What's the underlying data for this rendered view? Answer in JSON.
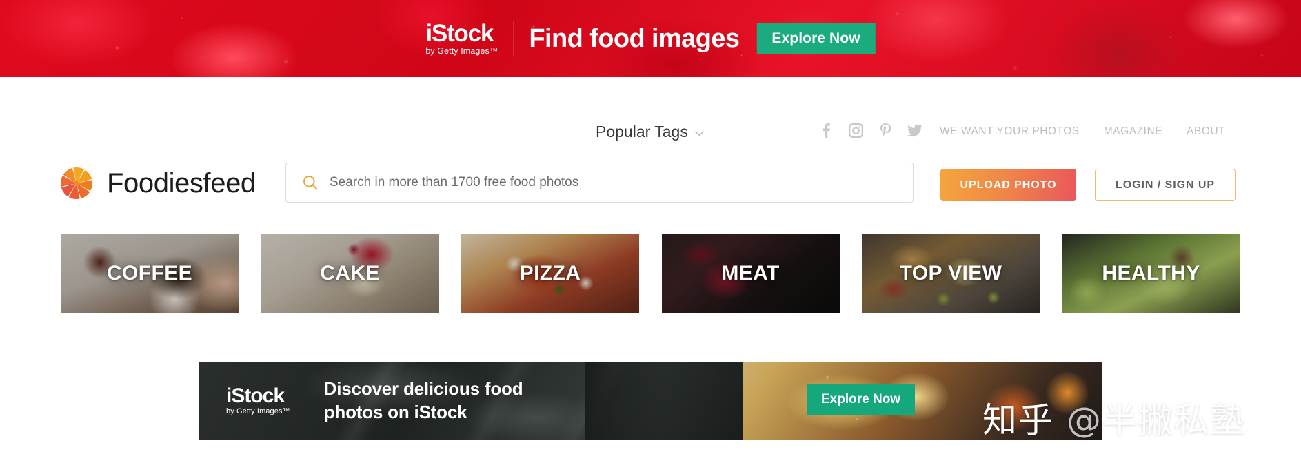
{
  "top_banner": {
    "brand": "iStock",
    "brand_sub": "by Getty Images™",
    "headline": "Find food images",
    "cta": "Explore Now",
    "bg_color": "#d9071b",
    "cta_color": "#1aab7e"
  },
  "util_nav": {
    "popular_tags": "Popular Tags",
    "chevron": "⌄",
    "social": [
      {
        "name": "facebook-icon"
      },
      {
        "name": "instagram-icon"
      },
      {
        "name": "pinterest-icon"
      },
      {
        "name": "twitter-icon"
      }
    ],
    "links": [
      {
        "label": "WE WANT YOUR PHOTOS"
      },
      {
        "label": "MAGAZINE"
      },
      {
        "label": "ABOUT"
      }
    ]
  },
  "header": {
    "logo_text": "Foodiesfeed",
    "logo_icon": "aperture-icon",
    "search": {
      "icon": "search-icon",
      "placeholder": "Search in more than 1700 free food photos",
      "value": ""
    },
    "upload_label": "UPLOAD PHOTO",
    "login_label": "LOGIN / SIGN UP",
    "accent_orange": "#f4a63c",
    "accent_red": "#e9575c"
  },
  "tiles": [
    {
      "label": "COFFEE",
      "bg": "bg-coffee"
    },
    {
      "label": "CAKE",
      "bg": "bg-cake"
    },
    {
      "label": "PIZZA",
      "bg": "bg-pizza"
    },
    {
      "label": "MEAT",
      "bg": "bg-meat"
    },
    {
      "label": "TOP VIEW",
      "bg": "bg-topview"
    },
    {
      "label": "HEALTHY",
      "bg": "bg-healthy"
    }
  ],
  "ad_banner": {
    "brand": "iStock",
    "brand_sub": "by Getty Images™",
    "headline_line1": "Discover delicious food",
    "headline_line2": "photos on iStock",
    "cta": "Explore Now",
    "cta_color": "#15a87c"
  },
  "watermark": {
    "site": "知乎",
    "handle": "@半撇私塾"
  }
}
